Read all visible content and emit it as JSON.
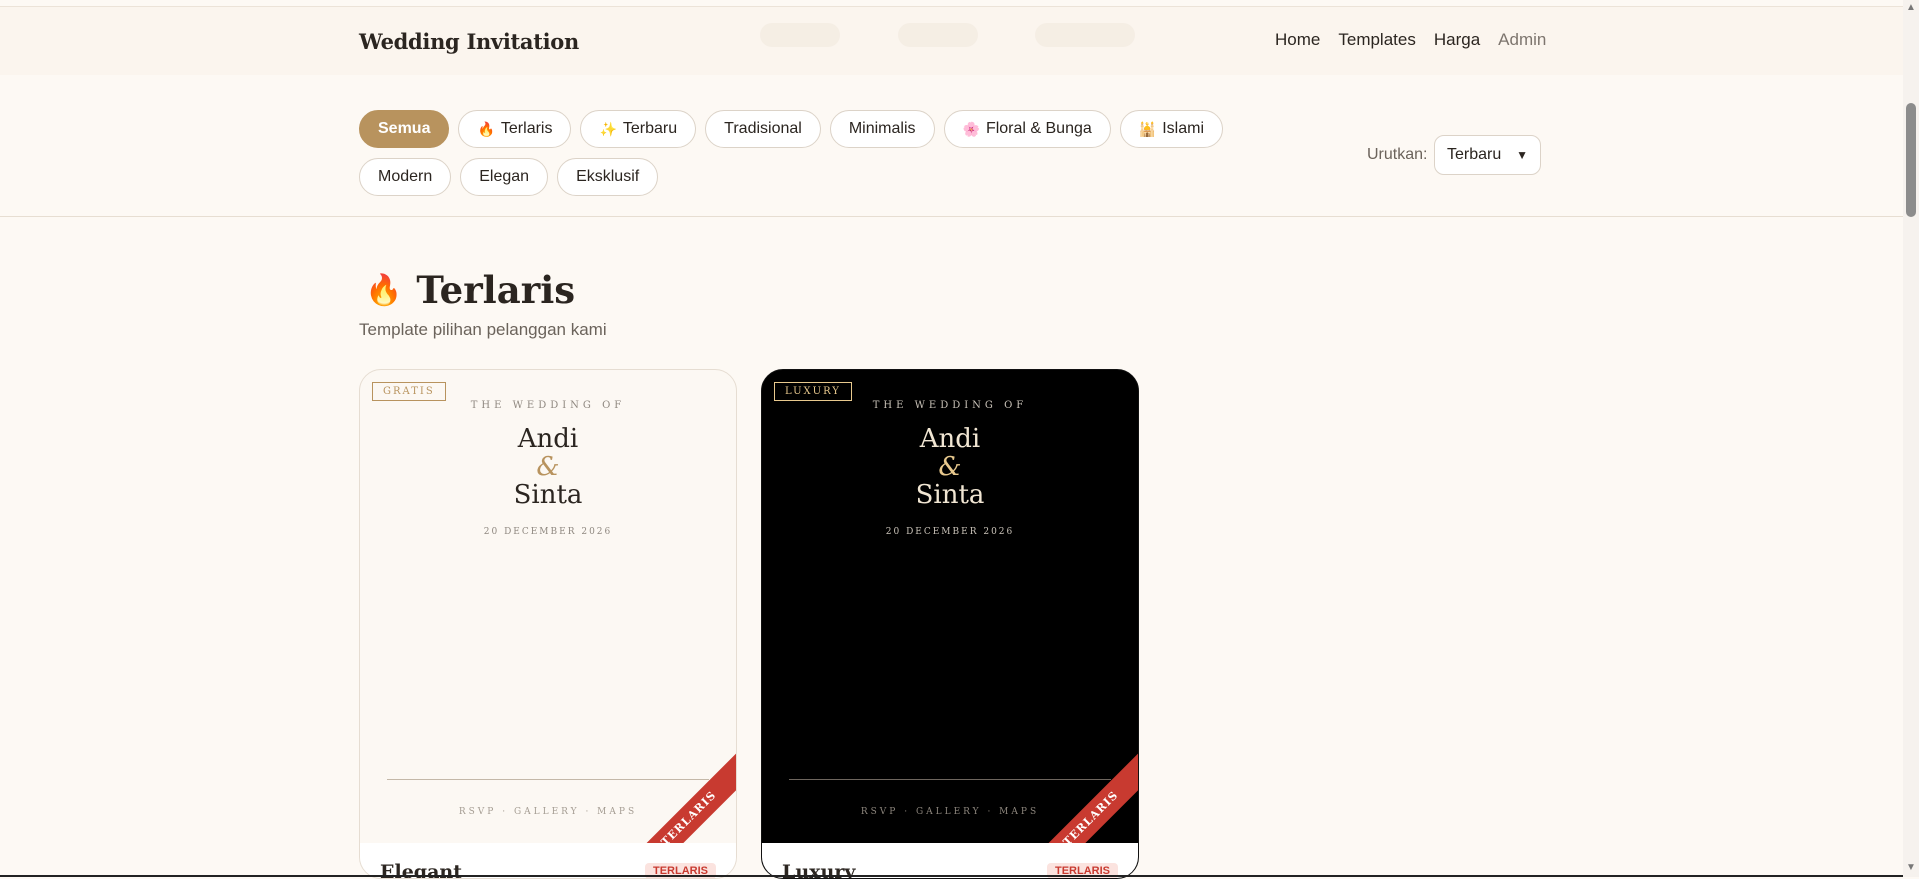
{
  "header": {
    "brand": "Wedding Invitation",
    "nav": [
      "Home",
      "Templates",
      "Harga",
      "Admin"
    ]
  },
  "filters": {
    "chips": [
      {
        "label": "Semua",
        "icon": "",
        "active": true
      },
      {
        "label": "Terlaris",
        "icon": "🔥",
        "active": false
      },
      {
        "label": "Terbaru",
        "icon": "✨",
        "active": false
      },
      {
        "label": "Tradisional",
        "icon": "",
        "active": false
      },
      {
        "label": "Minimalis",
        "icon": "",
        "active": false
      },
      {
        "label": "Floral & Bunga",
        "icon": "🌸",
        "active": false
      },
      {
        "label": "Islami",
        "icon": "🕌",
        "active": false
      },
      {
        "label": "Modern",
        "icon": "",
        "active": false
      },
      {
        "label": "Elegan",
        "icon": "",
        "active": false
      },
      {
        "label": "Eksklusif",
        "icon": "",
        "active": false
      }
    ],
    "sort_label": "Urutkan:",
    "sort_value": "Terbaru"
  },
  "section": {
    "icon": "🔥",
    "title": "Terlaris",
    "subtitle": "Template pilihan pelanggan kami"
  },
  "cards": [
    {
      "badge": "GRATIS",
      "wedding_of": "THE WEDDING OF",
      "name1": "Andi",
      "amp": "&",
      "name2": "Sinta",
      "date": "20 DECEMBER 2026",
      "links": "RSVP · GALLERY · MAPS",
      "ribbon": "TERLARIS",
      "title": "Elegant",
      "tag": "TERLARIS"
    },
    {
      "badge": "LUXURY",
      "wedding_of": "THE WEDDING OF",
      "name1": "Andi",
      "amp": "&",
      "name2": "Sinta",
      "date": "20 DECEMBER 2026",
      "links": "RSVP · GALLERY · MAPS",
      "ribbon": "TERLARIS",
      "title": "Luxury",
      "tag": "TERLARIS"
    }
  ],
  "colors": {
    "accent": "#b8935e",
    "ribbon": "#c83a30",
    "background": "#fdf9f4"
  }
}
